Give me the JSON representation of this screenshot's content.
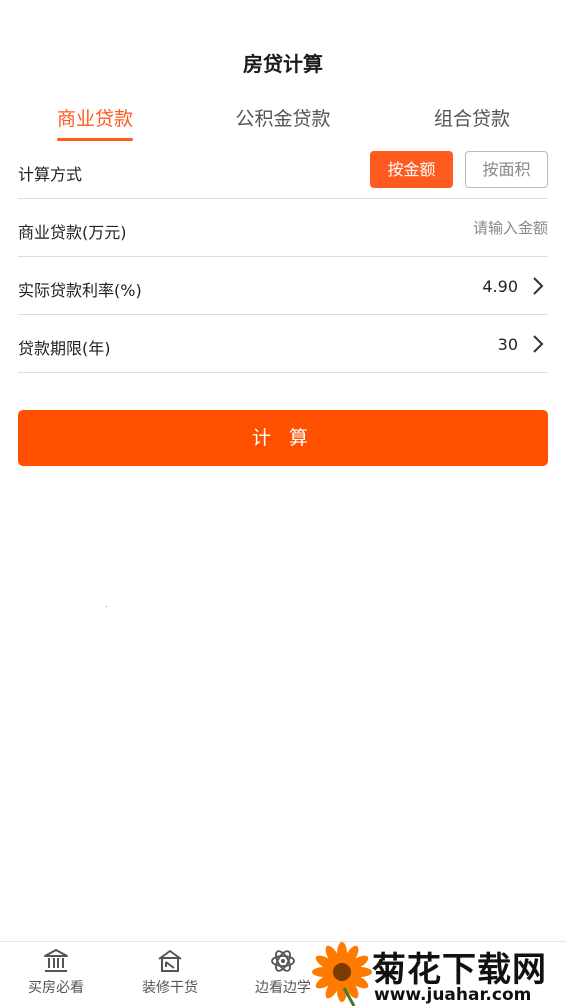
{
  "header": {
    "title": "房贷计算"
  },
  "tabs": [
    {
      "label": "商业贷款",
      "active": true
    },
    {
      "label": "公积金贷款",
      "active": false
    },
    {
      "label": "组合贷款",
      "active": false
    }
  ],
  "form": {
    "method": {
      "label": "计算方式",
      "options": [
        {
          "label": "按金额",
          "selected": true
        },
        {
          "label": "按面积",
          "selected": false
        }
      ]
    },
    "amount": {
      "label": "商业贷款(万元)",
      "placeholder": "请输入金额",
      "value": ""
    },
    "rate": {
      "label": "实际贷款利率(%)",
      "value": "4.90"
    },
    "term": {
      "label": "贷款期限(年)",
      "value": "30"
    }
  },
  "actions": {
    "calculate_label": "计 算"
  },
  "bottom_nav": {
    "items": [
      {
        "label": "买房必看",
        "icon": "bank-icon"
      },
      {
        "label": "装修干货",
        "icon": "house-tool-icon"
      },
      {
        "label": "边看边学",
        "icon": "atom-icon"
      }
    ]
  },
  "watermark": {
    "title": "菊花下载网",
    "url": "www.juahar.com",
    "icon": "flower-icon"
  },
  "colors": {
    "accent": "#ff5a1f",
    "divider": "#dddddd",
    "muted": "#888888"
  }
}
